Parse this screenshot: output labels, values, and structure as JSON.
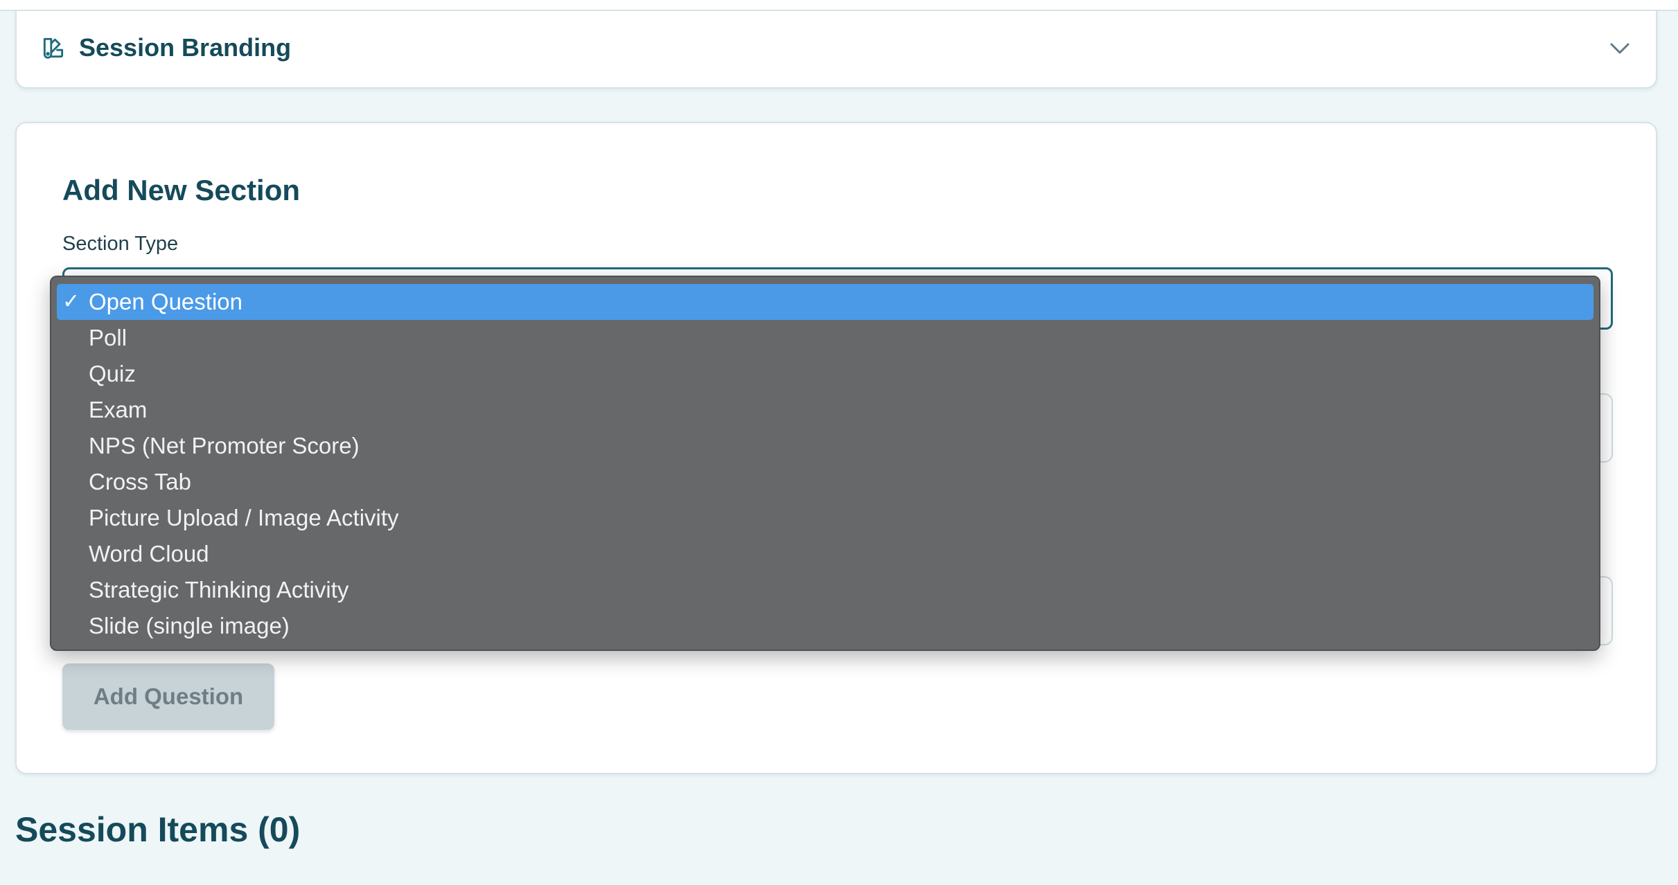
{
  "branding": {
    "title": "Session Branding",
    "icon": "palette-icon",
    "toggle_icon": "chevron-down-icon"
  },
  "section": {
    "title": "Add New Section",
    "type_label": "Section Type",
    "dropdown": {
      "selected_mark": "✓",
      "options": [
        "Open Question",
        "Poll",
        "Quiz",
        "Exam",
        "NPS (Net Promoter Score)",
        "Cross Tab",
        "Picture Upload / Image Activity",
        "Word Cloud",
        "Strategic Thinking Activity",
        "Slide (single image)"
      ],
      "selected_index": 0
    },
    "add_button": "Add Question"
  },
  "items": {
    "title": "Session Items (0)"
  },
  "colors": {
    "heading": "#154a5a",
    "page_background": "#eef6f8",
    "selected_option": "#4a9ae8",
    "dropdown_background": "#676869",
    "disabled_button": "#c8d3d8"
  }
}
